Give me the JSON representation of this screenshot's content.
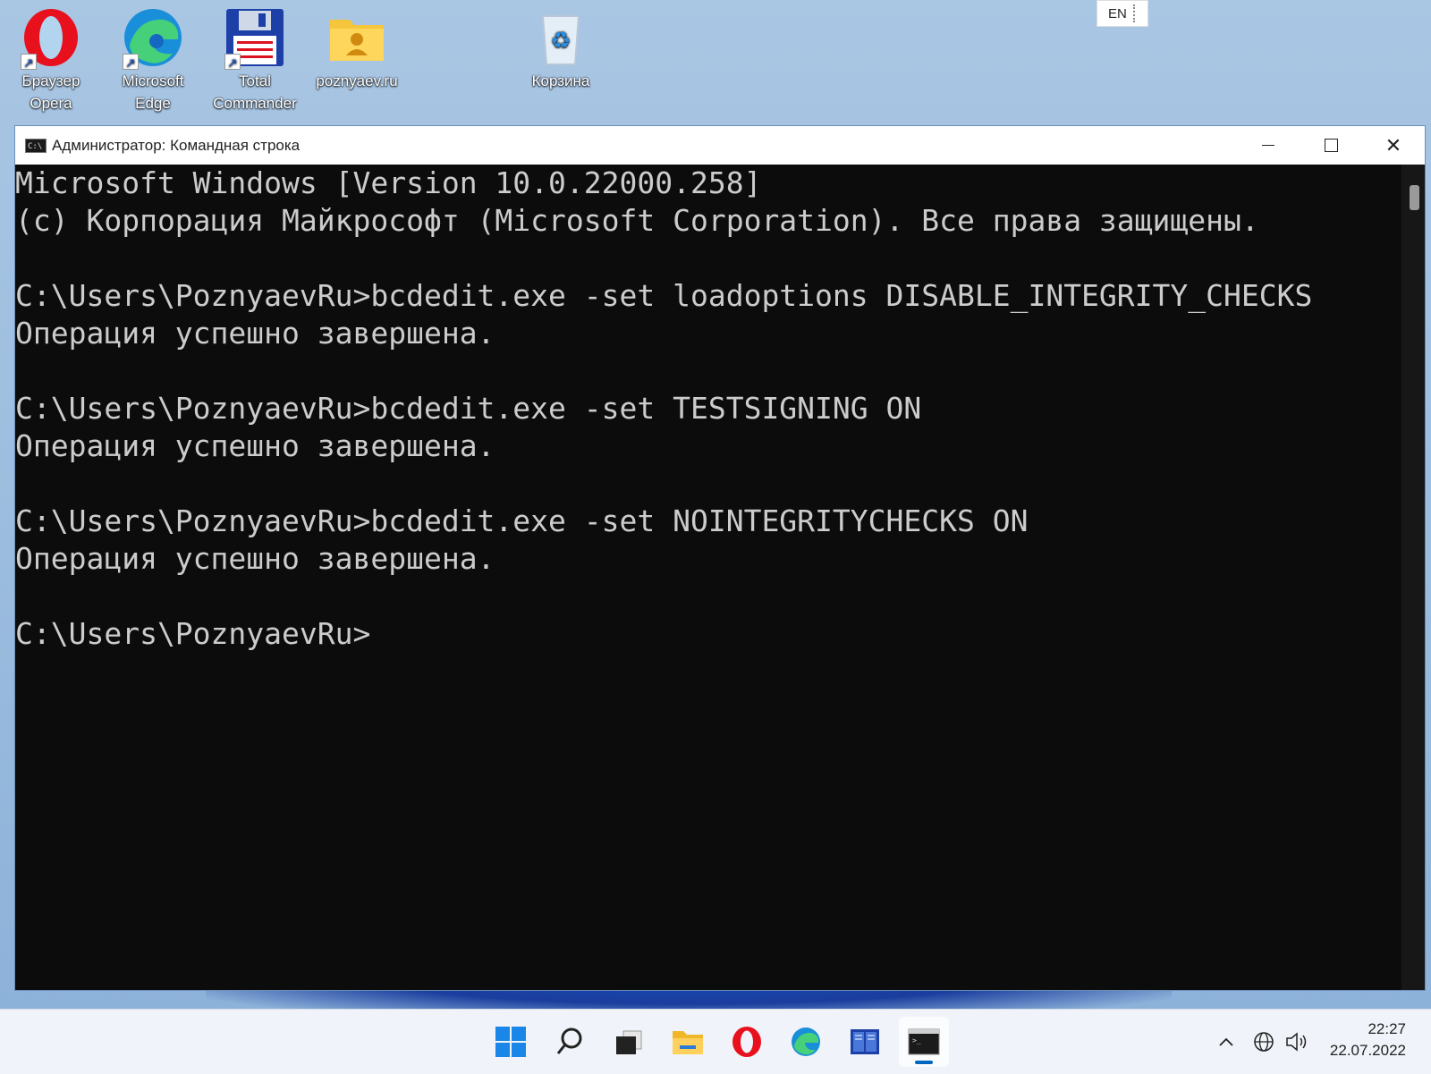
{
  "desktop": {
    "icons": [
      {
        "label_line1": "Браузер",
        "label_line2": "Opera"
      },
      {
        "label_line1": "Microsoft",
        "label_line2": "Edge"
      },
      {
        "label_line1": "Total",
        "label_line2": "Commander"
      },
      {
        "label_line1": "poznyaev.ru",
        "label_line2": ""
      },
      {
        "label_line1": "Корзина",
        "label_line2": ""
      }
    ],
    "language": "EN"
  },
  "window": {
    "title": "Администратор: Командная строка",
    "title_icon_text": "C:\\",
    "console_lines": [
      "Microsoft Windows [Version 10.0.22000.258]",
      "(c) Корпорация Майкрософт (Microsoft Corporation). Все права защищены.",
      "",
      "C:\\Users\\PoznyaevRu>bcdedit.exe -set loadoptions DISABLE_INTEGRITY_CHECKS",
      "Операция успешно завершена.",
      "",
      "C:\\Users\\PoznyaevRu>bcdedit.exe -set TESTSIGNING ON",
      "Операция успешно завершена.",
      "",
      "C:\\Users\\PoznyaevRu>bcdedit.exe -set NOINTEGRITYCHECKS ON",
      "Операция успешно завершена.",
      "",
      "C:\\Users\\PoznyaevRu>"
    ]
  },
  "taskbar": {
    "icons": [
      "windows-start-icon",
      "search-icon",
      "task-view-icon",
      "file-explorer-icon",
      "opera-icon",
      "edge-icon",
      "total-commander-icon",
      "command-prompt-icon"
    ],
    "clock": {
      "time": "22:27",
      "date": "22.07.2022"
    }
  },
  "colors": {
    "console_bg": "#0c0c0c",
    "console_text": "#cccccc",
    "accent": "#0067c0"
  }
}
